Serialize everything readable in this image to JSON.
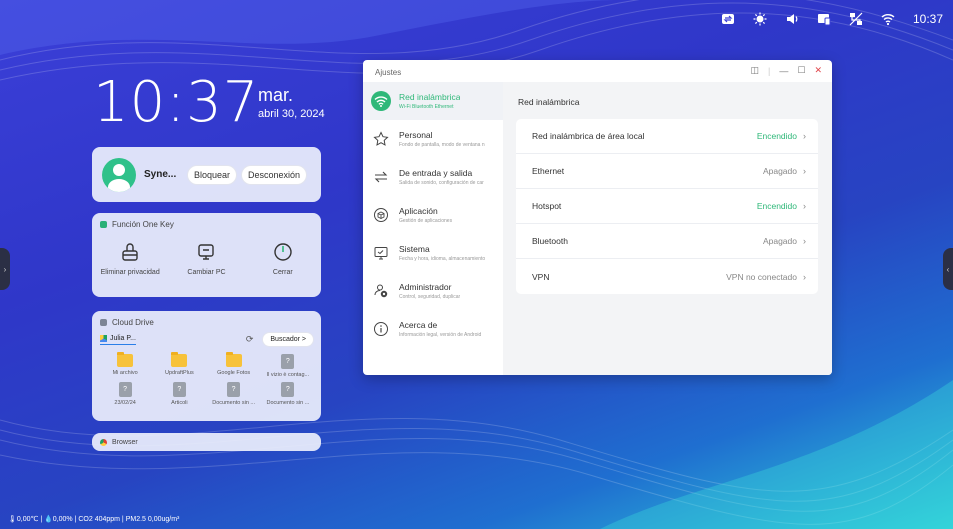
{
  "status_bar": {
    "time": "10:37",
    "icons": [
      "swap-icon",
      "brightness-icon",
      "volume-icon",
      "screen-share-icon",
      "network-off-icon",
      "wifi-icon"
    ]
  },
  "clock": {
    "time": "10:37",
    "day": "mar.",
    "date": "abril 30, 2024"
  },
  "user_card": {
    "name": "Syne...",
    "lock_label": "Bloquear",
    "logout_label": "Desconexión"
  },
  "one_key": {
    "title": "Función One Key",
    "items": [
      {
        "label": "Eliminar privacidad",
        "icon": "broom-icon"
      },
      {
        "label": "Cambiar PC",
        "icon": "monitor-icon"
      },
      {
        "label": "Cerrar",
        "icon": "power-icon"
      }
    ]
  },
  "cloud": {
    "title": "Cloud Drive",
    "account": "Julia P...",
    "search_label": "Buscador >",
    "files": [
      {
        "name": "Mi archivo",
        "type": "folder"
      },
      {
        "name": "UpdraftPlus",
        "type": "folder"
      },
      {
        "name": "Google Fotos",
        "type": "folder"
      },
      {
        "name": "Il vizio è contag...",
        "type": "doc"
      },
      {
        "name": "23/02/24",
        "type": "doc"
      },
      {
        "name": "Articoli",
        "type": "doc"
      },
      {
        "name": "Documento sin ...",
        "type": "doc"
      },
      {
        "name": "Documento sin ...",
        "type": "doc"
      }
    ]
  },
  "browser": {
    "title": "Browser"
  },
  "sensor_line": "🌡0,00℃ | 💧0,00% | CO2 404ppm | PM2.5 0,00ug/m³",
  "settings": {
    "window_title": "Ajustes",
    "nav": [
      {
        "label": "Red inalámbrica",
        "sub": "Wi-Fi Bluetooth Ethernet",
        "icon": "wifi-icon",
        "active": true
      },
      {
        "label": "Personal",
        "sub": "Fondo de pantalla, modo de ventana n",
        "icon": "star-icon"
      },
      {
        "label": "De entrada y salida",
        "sub": "Salida de sonido, configuración de car",
        "icon": "arrows-icon"
      },
      {
        "label": "Aplicación",
        "sub": "Gestión de aplicaciones",
        "icon": "cube-icon"
      },
      {
        "label": "Sistema",
        "sub": "Fecha y hora, idioma, almacenamiento",
        "icon": "display-icon"
      },
      {
        "label": "Administrador",
        "sub": "Control, seguridad, duplicar",
        "icon": "admin-icon"
      },
      {
        "label": "Acerca de",
        "sub": "Información legal, versión de Android",
        "icon": "info-icon"
      }
    ],
    "content_title": "Red inalámbrica",
    "rows": [
      {
        "label": "Red inalámbrica de área local",
        "value": "Encendido",
        "on": true
      },
      {
        "label": "Ethernet",
        "value": "Apagado",
        "on": false
      },
      {
        "label": "Hotspot",
        "value": "Encendido",
        "on": true
      },
      {
        "label": "Bluetooth",
        "value": "Apagado",
        "on": false
      },
      {
        "label": "VPN",
        "value": "VPN no conectado",
        "on": false
      }
    ],
    "colors": {
      "accent": "#2fb879",
      "close": "#e0454a"
    }
  }
}
